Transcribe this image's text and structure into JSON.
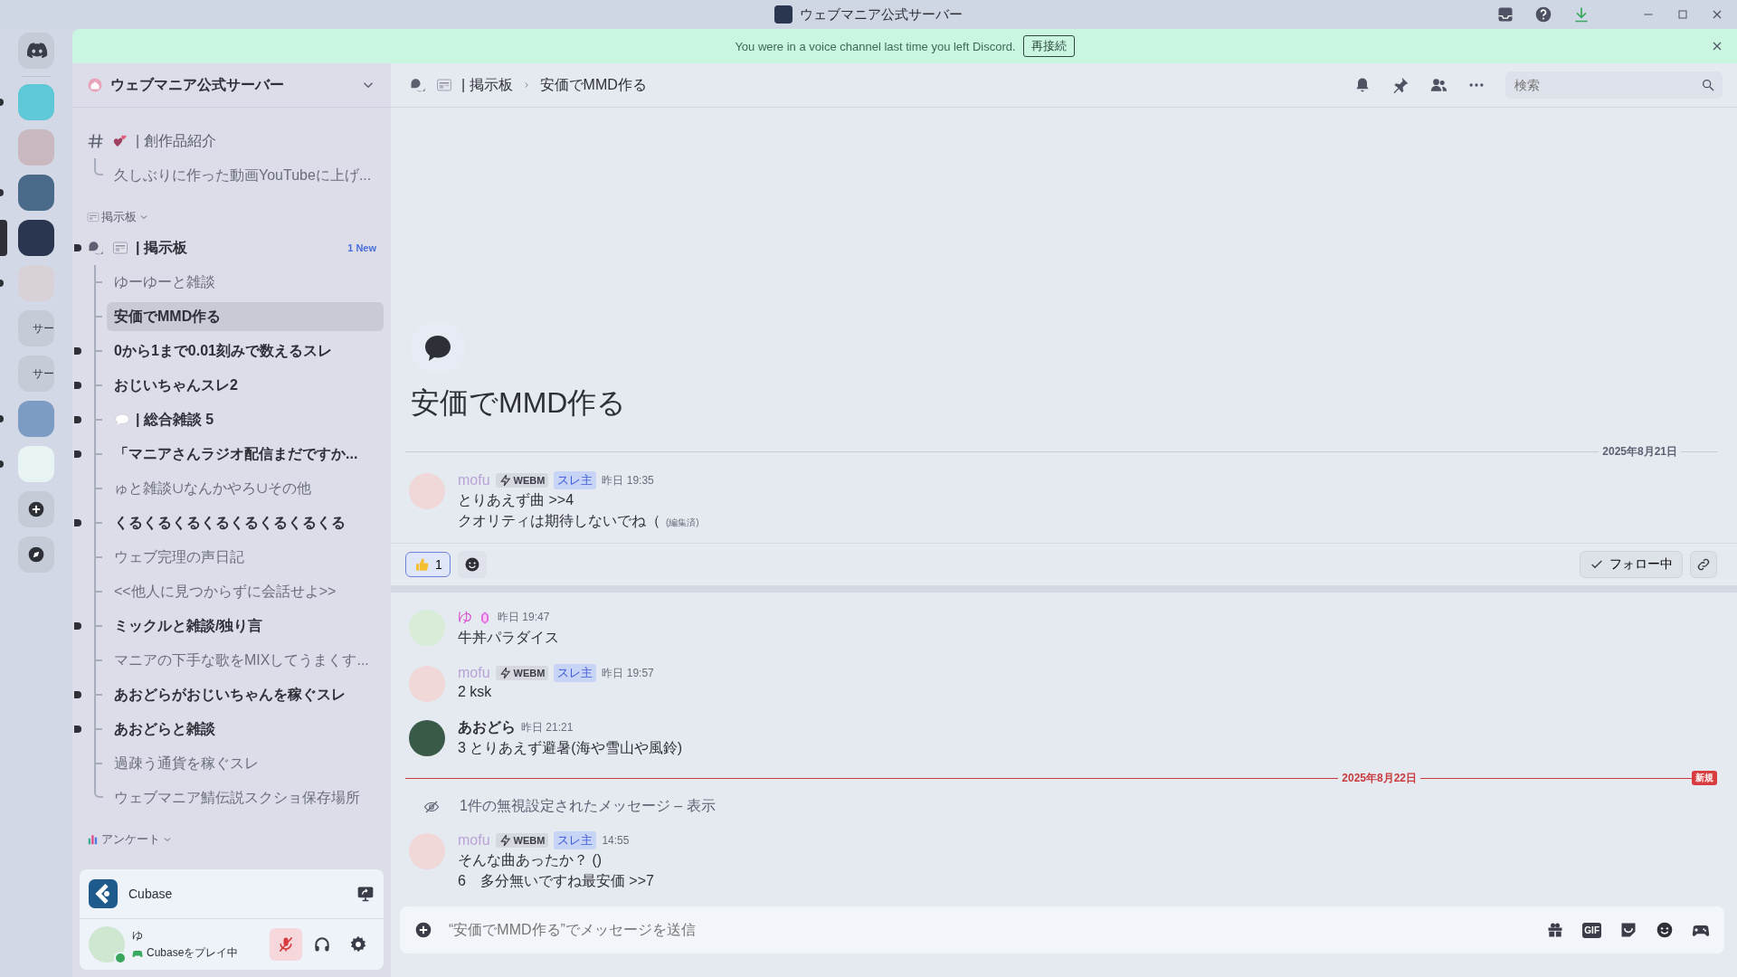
{
  "titlebar": {
    "title": "ウェブマニア公式サーバー"
  },
  "banner": {
    "text": "You were in a voice channel last time you left Discord.",
    "button": "再接続"
  },
  "servers": [
    {
      "kind": "home",
      "unread": false,
      "selected": false
    },
    {
      "kind": "image",
      "color": "#5ec8d8",
      "unread": true,
      "selected": false
    },
    {
      "kind": "image",
      "color": "#c9b8c0",
      "unread": false,
      "selected": false
    },
    {
      "kind": "image",
      "color": "#4a6a8a",
      "unread": true,
      "selected": false
    },
    {
      "kind": "image",
      "color": "#2a3550",
      "unread": false,
      "selected": true
    },
    {
      "kind": "image",
      "color": "#d8d2d8",
      "unread": true,
      "selected": false
    },
    {
      "kind": "text",
      "label": "サー",
      "unread": false,
      "selected": false
    },
    {
      "kind": "text",
      "label": "サー",
      "unread": false,
      "selected": false
    },
    {
      "kind": "image",
      "color": "#7c9cc4",
      "unread": true,
      "selected": false
    },
    {
      "kind": "image",
      "color": "#e8f4f4",
      "unread": true,
      "selected": false
    },
    {
      "kind": "add",
      "unread": false,
      "selected": false
    },
    {
      "kind": "discover",
      "unread": false,
      "selected": false
    }
  ],
  "sidebar": {
    "server_name": "ウェブマニア公式サーバー",
    "items": [
      {
        "kind": "channel",
        "name": "| 創作品紹介",
        "children": [
          {
            "name": "久しぶりに作った動画YouTubeに上げ...",
            "unread": false,
            "selected": false
          }
        ]
      },
      {
        "kind": "category",
        "name": "掲示板"
      },
      {
        "kind": "forum",
        "name": "| 掲示板",
        "badge": "1 New",
        "unread": true,
        "children": [
          {
            "name": "ゆーゆーと雑談",
            "unread": false,
            "selected": false
          },
          {
            "name": "安価でMMD作る",
            "unread": false,
            "selected": true
          },
          {
            "name": "0から1まで0.01刻みで数えるスレ",
            "unread": true,
            "selected": false
          },
          {
            "name": "おじいちゃんスレ2",
            "unread": true,
            "selected": false
          },
          {
            "name": "| 総合雑談 5",
            "unread": true,
            "selected": false,
            "kind": "bubble"
          },
          {
            "name": "「マニアさんラジオ配信まだですか...",
            "unread": true,
            "selected": false
          },
          {
            "name": "ゅと雑談∪なんかやろ∪その他",
            "unread": false,
            "selected": false
          },
          {
            "name": "くるくるくるくるくるくるくるくる",
            "unread": true,
            "selected": false
          },
          {
            "name": "ウェブ完理の声日記",
            "unread": false,
            "selected": false
          },
          {
            "name": "<<他人に見つからずに会話せよ>>",
            "unread": false,
            "selected": false
          },
          {
            "name": "ミックルと雑談/独り言",
            "unread": true,
            "selected": false
          },
          {
            "name": "マニアの下手な歌をMIXしてうまくす...",
            "unread": false,
            "selected": false
          },
          {
            "name": "あおどらがおじいちゃんを稼ぐスレ",
            "unread": true,
            "selected": false
          },
          {
            "name": "あおどらと雑談",
            "unread": true,
            "selected": false
          },
          {
            "name": "過疎う通貨を稼ぐスレ",
            "unread": false,
            "selected": false
          },
          {
            "name": "ウェブマニア鯖伝説スクショ保存場所",
            "unread": false,
            "selected": false
          }
        ]
      },
      {
        "kind": "category",
        "name": "アンケート"
      }
    ]
  },
  "activity": {
    "name": "Cubase"
  },
  "user": {
    "name": "ゆ",
    "status": "Cubaseをプレイ中",
    "muted": true
  },
  "header": {
    "forum": "| 掲示板",
    "thread": "安価でMMD作る",
    "search": {
      "placeholder": "検索"
    }
  },
  "thread": {
    "title": "安価でMMD作る",
    "feed": [
      {
        "kind": "divider",
        "date": "2025年8月21日",
        "new": false
      },
      {
        "kind": "message",
        "author": "mofu",
        "color": "#b9a3d6",
        "tags": [
          {
            "kind": "guild",
            "text": "WEBM"
          },
          {
            "kind": "op",
            "text": "スレ主"
          }
        ],
        "time": "昨日 19:35",
        "lines": [
          "とりあえず曲 >>4",
          "クオリティは期待しないでね（"
        ],
        "edited": "(編集済)"
      },
      {
        "kind": "reactions",
        "reactions": [
          {
            "count": "1",
            "selected": true
          }
        ],
        "follow": {
          "label": "フォロー中",
          "following": true
        }
      },
      {
        "kind": "message",
        "author": "ゆ",
        "color": "#d94fd0",
        "badge": true,
        "time": "昨日 19:47",
        "lines": [
          "牛丼パラダイス"
        ]
      },
      {
        "kind": "message",
        "author": "mofu",
        "color": "#b9a3d6",
        "tags": [
          {
            "kind": "guild",
            "text": "WEBM"
          },
          {
            "kind": "op",
            "text": "スレ主"
          }
        ],
        "time": "昨日 19:57",
        "lines": [
          "2 ksk"
        ]
      },
      {
        "kind": "message",
        "author": "あおどら",
        "color": "#2e3038",
        "time": "昨日 21:21",
        "lines": [
          "3 とりあえず避暑(海や雪山や風鈴)"
        ]
      },
      {
        "kind": "divider",
        "date": "2025年8月22日",
        "new": true,
        "new_label": "新規"
      },
      {
        "kind": "ignored",
        "text": "1件の無視設定されたメッセージ – 表示"
      },
      {
        "kind": "message",
        "author": "mofu",
        "color": "#b9a3d6",
        "tags": [
          {
            "kind": "guild",
            "text": "WEBM"
          },
          {
            "kind": "op",
            "text": "スレ主"
          }
        ],
        "time": "14:55",
        "lines": [
          "そんな曲あったか？ ()",
          "6　多分無いですね最安価 >>7"
        ]
      }
    ]
  },
  "composer": {
    "placeholder": "“安価でMMD作る”でメッセージを送信",
    "gif": "GIF"
  }
}
